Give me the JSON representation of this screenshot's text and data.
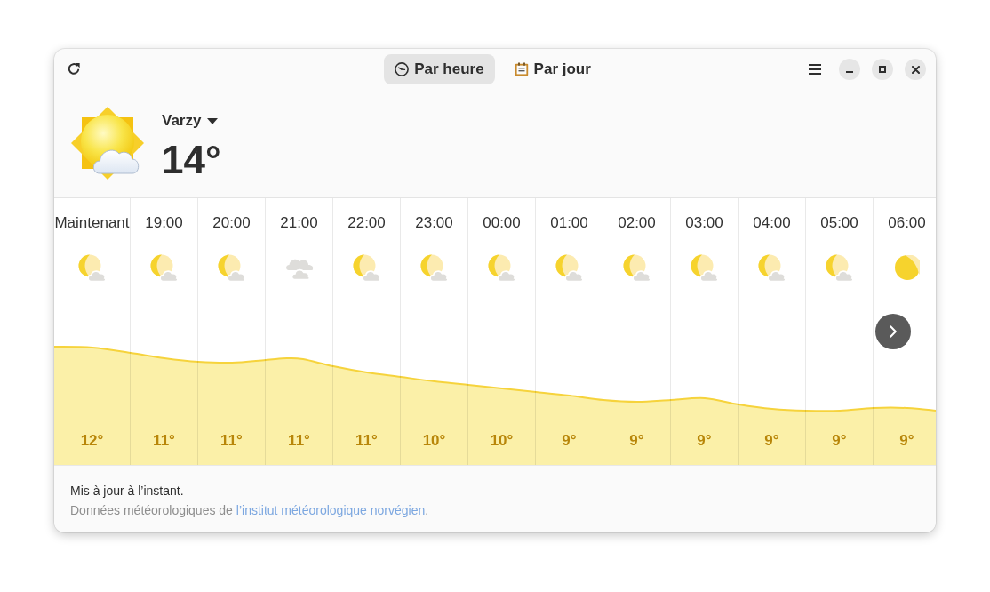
{
  "header": {
    "tabs": [
      {
        "label": "Par heure",
        "kind": "hourly",
        "selected": true
      },
      {
        "label": "Par jour",
        "kind": "daily",
        "selected": false
      }
    ]
  },
  "current": {
    "location": "Varzy",
    "temperature": "14°",
    "kind": "few-clouds"
  },
  "hourly": [
    {
      "time": "Maintenant",
      "kind": "night-few-clouds",
      "temperature": "12°"
    },
    {
      "time": "19:00",
      "kind": "night-few-clouds",
      "temperature": "11°"
    },
    {
      "time": "20:00",
      "kind": "night-few-clouds",
      "temperature": "11°"
    },
    {
      "time": "21:00",
      "kind": "overcast",
      "temperature": "11°"
    },
    {
      "time": "22:00",
      "kind": "night-few-clouds",
      "temperature": "11°"
    },
    {
      "time": "23:00",
      "kind": "night-few-clouds",
      "temperature": "10°"
    },
    {
      "time": "00:00",
      "kind": "night-few-clouds",
      "temperature": "10°"
    },
    {
      "time": "01:00",
      "kind": "night-few-clouds",
      "temperature": "9°"
    },
    {
      "time": "02:00",
      "kind": "night-few-clouds",
      "temperature": "9°"
    },
    {
      "time": "03:00",
      "kind": "night-few-clouds",
      "temperature": "9°"
    },
    {
      "time": "04:00",
      "kind": "night-few-clouds",
      "temperature": "9°"
    },
    {
      "time": "05:00",
      "kind": "night-few-clouds",
      "temperature": "9°"
    },
    {
      "time": "06:00",
      "kind": "night-clear",
      "temperature": "9°"
    }
  ],
  "footer": {
    "updated": "Mis à jour à l’instant.",
    "attribution": "Données météorologiques de ",
    "source_link": "l’institut météorologique norvégien",
    "attribution_end": "."
  }
}
